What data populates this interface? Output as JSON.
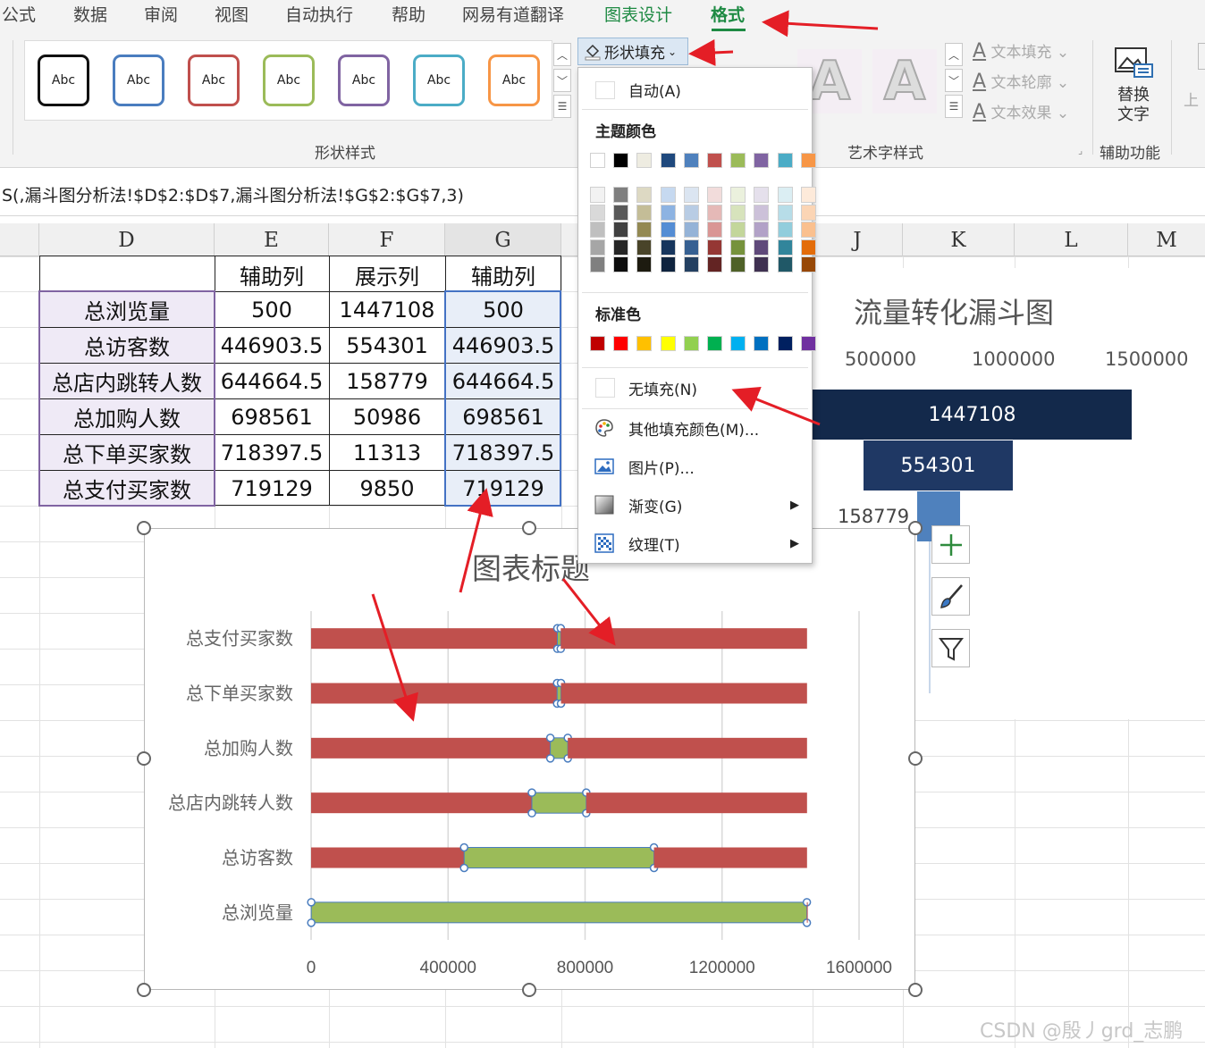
{
  "ribbon": {
    "tabs": [
      {
        "label": "公式"
      },
      {
        "label": "数据"
      },
      {
        "label": "审阅"
      },
      {
        "label": "视图"
      },
      {
        "label": "自动执行"
      },
      {
        "label": "帮助"
      },
      {
        "label": "网易有道翻译"
      },
      {
        "label": "图表设计"
      },
      {
        "label": "格式"
      }
    ],
    "active_tab": "格式",
    "style_gallery": {
      "sample_text": "Abc",
      "border_colors": [
        "#111111",
        "#4a7dbf",
        "#c0504d",
        "#9bbb59",
        "#8064a2",
        "#4bacc6",
        "#f79646"
      ]
    },
    "shape_styles_label": "形状样式",
    "shape_fill_label": "形状填充",
    "wordart_letter": "A",
    "text_fill": "文本填充",
    "text_outline": "文本轮廓",
    "text_effect": "文本效果",
    "wordart_label": "艺术字样式",
    "alt_text": "替换文字",
    "accessibility_label": "辅助功能",
    "partial_label": "上"
  },
  "formula_bar": {
    "text": "S(,漏斗图分析法!$D$2:$D$7,漏斗图分析法!$G$2:$G$7,3)"
  },
  "columns": [
    "D",
    "E",
    "F",
    "G",
    "J",
    "K",
    "L",
    "M"
  ],
  "table": {
    "headers": [
      "",
      "辅助列",
      "展示列",
      "辅助列"
    ],
    "rows": [
      [
        "总浏览量",
        "500",
        "1447108",
        "500"
      ],
      [
        "总访客数",
        "446903.5",
        "554301",
        "446903.5"
      ],
      [
        "总店内跳转人数",
        "644664.5",
        "158779",
        "644664.5"
      ],
      [
        "总加购人数",
        "698561",
        "50986",
        "698561"
      ],
      [
        "总下单买家数",
        "718397.5",
        "11313",
        "718397.5"
      ],
      [
        "总支付买家数",
        "719129",
        "9850",
        "719129"
      ]
    ]
  },
  "dropdown": {
    "auto": "自动(A)",
    "theme_colors_title": "主题颜色",
    "theme_top": [
      "#ffffff",
      "#000000",
      "#eeece1",
      "#1f497d",
      "#4f81bd",
      "#c0504d",
      "#9bbb59",
      "#8064a2",
      "#4bacc6",
      "#f79646"
    ],
    "theme_shades": [
      [
        "#f2f2f2",
        "#d9d9d9",
        "#bfbfbf",
        "#a6a6a6",
        "#808080"
      ],
      [
        "#7f7f7f",
        "#595959",
        "#404040",
        "#262626",
        "#0d0d0d"
      ],
      [
        "#ddd9c3",
        "#c4bd97",
        "#938953",
        "#494429",
        "#1d1b10"
      ],
      [
        "#c6d9f0",
        "#8db3e2",
        "#548dd4",
        "#17365d",
        "#0f243e"
      ],
      [
        "#dbe5f1",
        "#b8cce4",
        "#95b3d7",
        "#366092",
        "#244061"
      ],
      [
        "#f2dcdb",
        "#e5b9b7",
        "#d99694",
        "#953734",
        "#632423"
      ],
      [
        "#ebf1dd",
        "#d7e3bc",
        "#c3d69b",
        "#76923c",
        "#4f6128"
      ],
      [
        "#e5e0ec",
        "#ccc1d9",
        "#b2a2c7",
        "#5f497a",
        "#3f3151"
      ],
      [
        "#dbeef3",
        "#b7dde8",
        "#92cddc",
        "#31859b",
        "#205867"
      ],
      [
        "#fdeada",
        "#fbd5b5",
        "#fac08f",
        "#e36c09",
        "#974806"
      ]
    ],
    "standard_colors_title": "标准色",
    "standard_colors": [
      "#c00000",
      "#ff0000",
      "#ffc000",
      "#ffff00",
      "#92d050",
      "#00b050",
      "#00b0f0",
      "#0070c0",
      "#002060",
      "#7030a0"
    ],
    "no_fill": "无填充(N)",
    "more_colors": "其他填充颜色(M)...",
    "picture": "图片(P)...",
    "gradient": "渐变(G)",
    "texture": "纹理(T)"
  },
  "chart_data": [
    {
      "type": "bar",
      "title": "图表标题",
      "categories": [
        "总浏览量",
        "总访客数",
        "总店内跳转人数",
        "总加购人数",
        "总下单买家数",
        "总支付买家数"
      ],
      "series": [
        {
          "values": [
            500,
            446903.5,
            644664.5,
            698561,
            718397.5,
            719129
          ],
          "color": "#c0504d"
        },
        {
          "values": [
            1447108,
            554301,
            158779,
            50986,
            11313,
            9850
          ],
          "color": "#9bbb59"
        },
        {
          "values": [
            500,
            446903.5,
            644664.5,
            698561,
            718397.5,
            719129
          ],
          "color": "#c0504d"
        }
      ],
      "stacked": true,
      "xlim": [
        0,
        1600000
      ],
      "xticks": [
        "0",
        "400000",
        "800000",
        "1200000",
        "1600000"
      ],
      "grid": true
    },
    {
      "type": "bar",
      "title": "流量转化漏斗图",
      "xticks": [
        "500000",
        "1000000",
        "1500000"
      ],
      "bars": [
        {
          "label": "1447108",
          "value": 1447108,
          "color": "#13294b"
        },
        {
          "label": "554301",
          "value": 554301,
          "color": "#1f3864"
        },
        {
          "label": "158779",
          "value": 158779,
          "color": "#4f81bd"
        }
      ]
    }
  ],
  "watermark": "CSDN @殷丿grd_志鹏"
}
